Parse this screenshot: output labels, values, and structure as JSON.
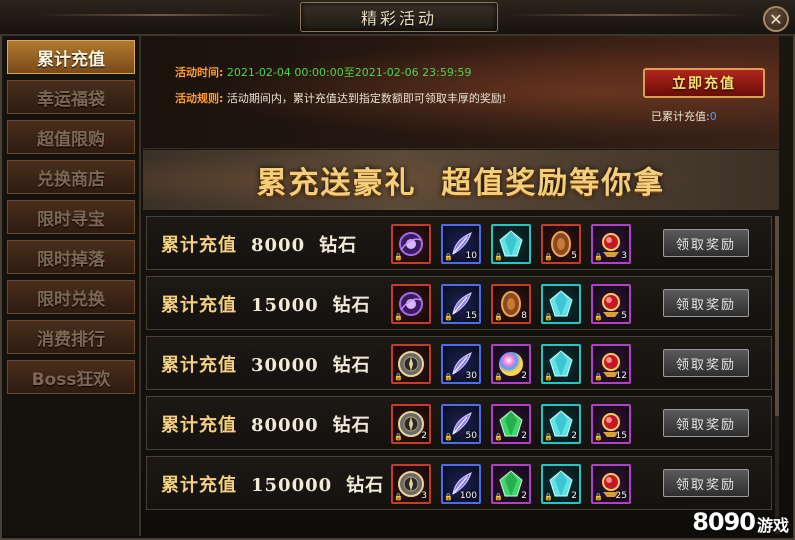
{
  "window": {
    "title": "精彩活动",
    "close_label": "✕"
  },
  "sidebar": {
    "items": [
      {
        "label": "累计充值",
        "active": true
      },
      {
        "label": "幸运福袋",
        "active": false
      },
      {
        "label": "超值限购",
        "active": false
      },
      {
        "label": "兑换商店",
        "active": false
      },
      {
        "label": "限时寻宝",
        "active": false
      },
      {
        "label": "限时掉落",
        "active": false
      },
      {
        "label": "限时兑换",
        "active": false
      },
      {
        "label": "消费排行",
        "active": false
      },
      {
        "label": "Boss狂欢",
        "active": false
      }
    ]
  },
  "header": {
    "time_label": "活动时间:",
    "time_value": "2021-02-04 00:00:00至2021-02-06 23:59:59",
    "rule_label": "活动规则:",
    "rule_value": "活动期间内，累计充值达到指定数额即可领取丰厚的奖励!",
    "recharge_button": "立即充值",
    "accumulated_label": "已累计充值:",
    "accumulated_value": "0"
  },
  "slogan": "累充送豪礼  超值奖励等你拿",
  "rewards": [
    {
      "label": "累计充值",
      "amount": "8000",
      "unit": "钻石",
      "claim": "领取奖励",
      "items": [
        {
          "icon": "purple-orb-icon",
          "color": "red",
          "count": ""
        },
        {
          "icon": "feather-icon",
          "color": "blue",
          "count": "10"
        },
        {
          "icon": "cyan-crystal-icon",
          "color": "cyan",
          "count": ""
        },
        {
          "icon": "bronze-medal-icon",
          "color": "red",
          "count": "5"
        },
        {
          "icon": "red-gem-icon",
          "color": "purple",
          "count": "3"
        }
      ]
    },
    {
      "label": "累计充值",
      "amount": "15000",
      "unit": "钻石",
      "claim": "领取奖励",
      "items": [
        {
          "icon": "purple-orb-icon",
          "color": "red",
          "count": ""
        },
        {
          "icon": "feather-icon",
          "color": "blue",
          "count": "15"
        },
        {
          "icon": "bronze-medal-icon",
          "color": "red",
          "count": "8"
        },
        {
          "icon": "cyan-crystal-icon",
          "color": "cyan",
          "count": ""
        },
        {
          "icon": "red-gem-icon",
          "color": "purple",
          "count": "5"
        }
      ]
    },
    {
      "label": "累计充值",
      "amount": "30000",
      "unit": "钻石",
      "claim": "领取奖励",
      "items": [
        {
          "icon": "compass-icon",
          "color": "red",
          "count": ""
        },
        {
          "icon": "feather-icon",
          "color": "blue",
          "count": "30"
        },
        {
          "icon": "rainbow-orb-icon",
          "color": "purple",
          "count": "2"
        },
        {
          "icon": "cyan-crystal-icon",
          "color": "cyan",
          "count": ""
        },
        {
          "icon": "red-gem-icon",
          "color": "purple",
          "count": "12"
        }
      ]
    },
    {
      "label": "累计充值",
      "amount": "80000",
      "unit": "钻石",
      "claim": "领取奖励",
      "items": [
        {
          "icon": "compass-icon",
          "color": "red",
          "count": "2"
        },
        {
          "icon": "feather-icon",
          "color": "blue",
          "count": "50"
        },
        {
          "icon": "green-crystal-icon",
          "color": "purple",
          "count": "2"
        },
        {
          "icon": "cyan-crystal-icon",
          "color": "cyan",
          "count": "2"
        },
        {
          "icon": "red-gem-icon",
          "color": "purple",
          "count": "15"
        }
      ]
    },
    {
      "label": "累计充值",
      "amount": "150000",
      "unit": "钻石",
      "claim": "领取奖励",
      "items": [
        {
          "icon": "compass-icon",
          "color": "red",
          "count": "3"
        },
        {
          "icon": "feather-icon",
          "color": "blue",
          "count": "100"
        },
        {
          "icon": "green-crystal-icon",
          "color": "purple",
          "count": "2"
        },
        {
          "icon": "cyan-crystal-icon",
          "color": "cyan",
          "count": "2"
        },
        {
          "icon": "red-gem-icon",
          "color": "purple",
          "count": "25"
        }
      ]
    }
  ],
  "watermark": {
    "number": "8090",
    "text": "游戏"
  }
}
